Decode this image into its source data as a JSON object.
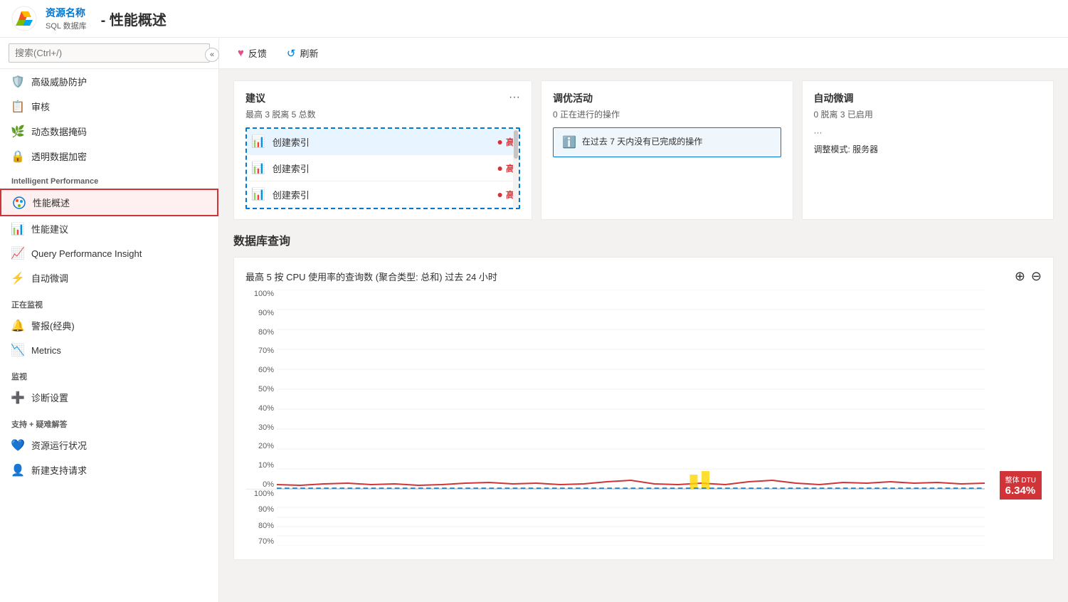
{
  "topbar": {
    "resource_name": "资源名称",
    "subtitle": "SQL 数据库",
    "page_title": "- 性能概述",
    "logo_colors": [
      "#f25022",
      "#7fba00",
      "#00a4ef",
      "#ffb900"
    ]
  },
  "toolbar": {
    "feedback_label": "反馈",
    "refresh_label": "刷新"
  },
  "sidebar": {
    "search_placeholder": "搜索(Ctrl+/)",
    "sections": [
      {
        "items": [
          {
            "label": "高级威胁防护",
            "icon": "🛡️"
          },
          {
            "label": "审核",
            "icon": "📋"
          },
          {
            "label": "动态数据掩码",
            "icon": "🌿"
          },
          {
            "label": "透明数据加密",
            "icon": "🔒"
          }
        ]
      },
      {
        "header": "Intelligent Performance",
        "items": [
          {
            "label": "性能概述",
            "icon": "⚡",
            "active": true
          },
          {
            "label": "性能建议",
            "icon": "📊"
          },
          {
            "label": "Query Performance Insight",
            "icon": "📈"
          },
          {
            "label": "自动微调",
            "icon": "⚡"
          }
        ]
      },
      {
        "header": "正在监视",
        "items": [
          {
            "label": "警报(经典)",
            "icon": "🔔"
          },
          {
            "label": "Metrics",
            "icon": "📉"
          }
        ]
      },
      {
        "header": "监视",
        "items": [
          {
            "label": "诊断设置",
            "icon": "➕"
          }
        ]
      },
      {
        "header": "支持 + 疑难解答",
        "items": [
          {
            "label": "资源运行状况",
            "icon": "💙"
          },
          {
            "label": "新建支持请求",
            "icon": "👤"
          }
        ]
      }
    ]
  },
  "cards": {
    "recommendations": {
      "title": "建议",
      "subtitle": "最高 3 脱离 5 总数",
      "more_icon": "···",
      "items": [
        {
          "label": "创建索引",
          "severity": "高"
        },
        {
          "label": "创建索引",
          "severity": "高"
        },
        {
          "label": "创建索引",
          "severity": "高"
        }
      ]
    },
    "tuning": {
      "title": "调优活动",
      "subtitle": "0 正在进行的操作",
      "info_text": "在过去 7 天内没有已完成的操作"
    },
    "auto_tune": {
      "title": "自动微调",
      "subtitle": "0 脱离 3 已启用",
      "extra": "···",
      "mode_label": "调整模式: 服务器"
    }
  },
  "db_query": {
    "section_title": "数据库查询",
    "chart_title": "最高 5 按 CPU 使用率的查询数 (聚合类型: 总和) 过去 24 小时",
    "y_axis_labels": [
      "100%",
      "90%",
      "80%",
      "70%",
      "60%",
      "50%",
      "40%",
      "30%",
      "20%",
      "10%",
      "0%",
      "100%",
      "90%",
      "80%",
      "70%"
    ],
    "dtu_label": "整体 DTU",
    "dtu_value": "6.34%"
  }
}
